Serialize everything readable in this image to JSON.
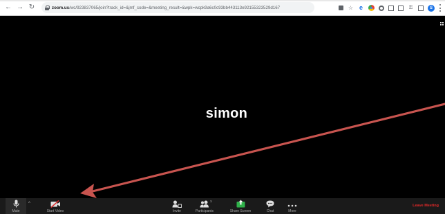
{
  "browser": {
    "url_host": "zoom.us",
    "url_path": "/wc/923837065/join?track_id=&jmf_code=&meeting_result=&wpk=wcpk9a6c0c93bb443113e92155323529d167",
    "profile_initial": "S"
  },
  "meeting": {
    "participant_name": "simon"
  },
  "toolbar": {
    "mute_label": "Mute",
    "start_video_label": "Start Video",
    "invite_label": "Invite",
    "participants_label": "Participants",
    "participants_count": "1",
    "share_screen_label": "Share Screen",
    "chat_label": "Chat",
    "more_label": "More",
    "leave_label": "Leave Meeting"
  },
  "colors": {
    "annotation_arrow": "#c8544f",
    "share_green": "#2fb14a",
    "leave_red": "#e02828",
    "toolbar_bg": "#1a1a1a"
  }
}
